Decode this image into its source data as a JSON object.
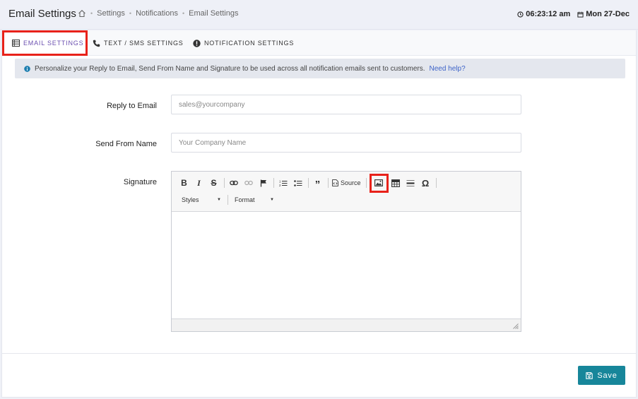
{
  "header": {
    "title": "Email Settings",
    "breadcrumbs": [
      "Settings",
      "Notifications",
      "Email Settings"
    ],
    "time": "06:23:12 am",
    "date": "Mon 27-Dec"
  },
  "tabs": [
    {
      "label": "Email Settings",
      "icon": "list-icon",
      "active": true
    },
    {
      "label": "Text / SMS Settings",
      "icon": "phone-icon",
      "active": false
    },
    {
      "label": "Notification Settings",
      "icon": "exclamation-circle-icon",
      "active": false
    }
  ],
  "info": {
    "text": "Personalize your Reply to Email, Send From Name and Signature to be used across all notification emails sent to customers.",
    "link": "Need help?"
  },
  "form": {
    "reply_label": "Reply to Email",
    "reply_placeholder": "sales@yourcompany",
    "from_label": "Send From Name",
    "from_placeholder": "Your Company Name",
    "signature_label": "Signature"
  },
  "editor": {
    "source_label": "Source",
    "styles_label": "Styles",
    "format_label": "Format"
  },
  "footer": {
    "save_label": "Save"
  },
  "colors": {
    "accent": "#6b4fb0",
    "save": "#17869a",
    "highlight": "#e8221a",
    "link": "#3d63c8"
  }
}
